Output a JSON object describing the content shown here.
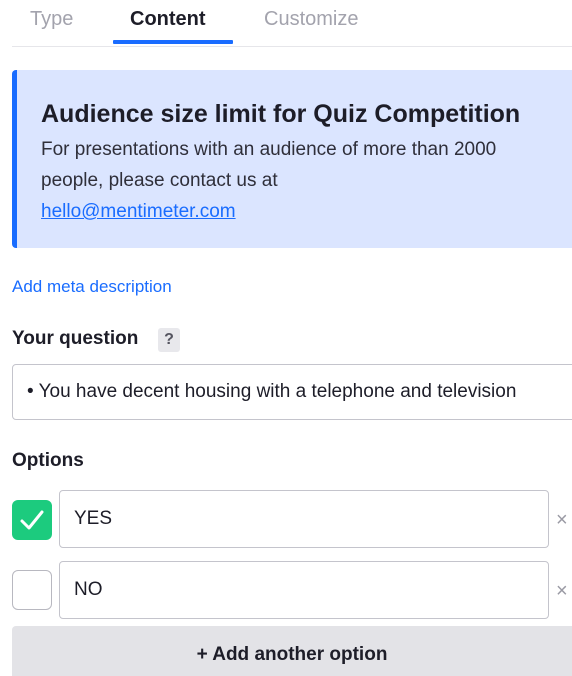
{
  "tabs": [
    {
      "label": "Type",
      "active": false
    },
    {
      "label": "Content",
      "active": true
    },
    {
      "label": "Customize",
      "active": false
    }
  ],
  "banner": {
    "title": "Audience size limit for Quiz Competition",
    "body": "For presentations with an audience of more than 2000 people, please contact us at",
    "link": "hello@mentimeter.com"
  },
  "meta_link": "Add meta description",
  "question": {
    "label": "Your question",
    "help": "?",
    "value": "• You have decent housing with a telephone and television"
  },
  "options": {
    "label": "Options",
    "items": [
      {
        "value": "YES",
        "correct": true
      },
      {
        "value": "NO",
        "correct": false
      }
    ],
    "remove_glyph": "×",
    "add_label": "+ Add another option"
  },
  "colors": {
    "accent": "#196cff",
    "correct": "#1ccb7e",
    "banner_bg": "#dbe5ff"
  }
}
